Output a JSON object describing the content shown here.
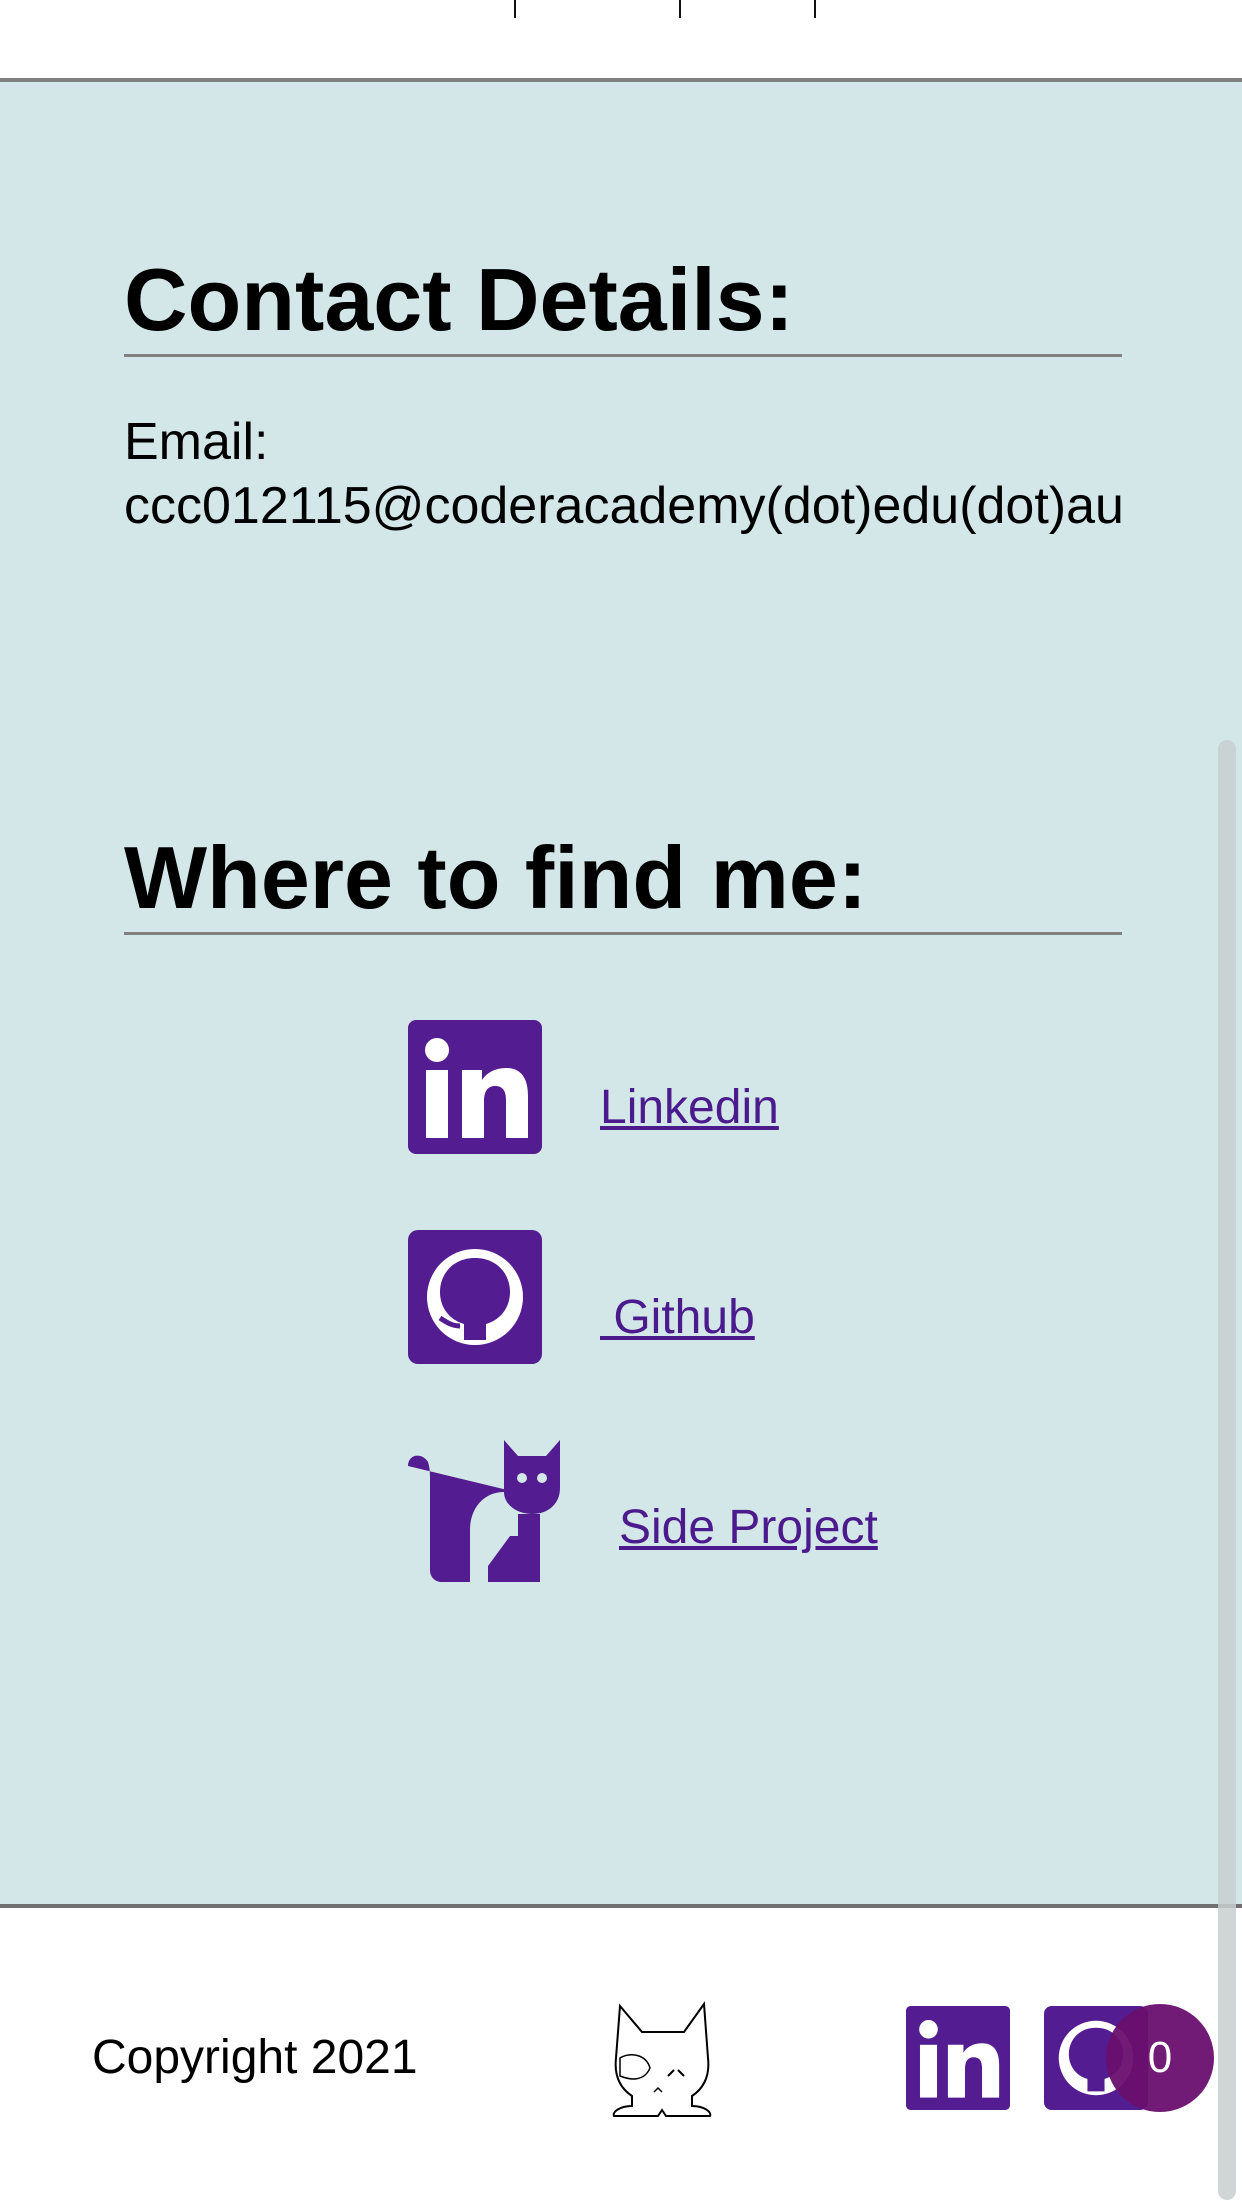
{
  "contact": {
    "title": "Contact Details:",
    "email_label": "Email:",
    "email_value": "ccc012115@coderacademy(dot)edu(dot)au"
  },
  "find_me": {
    "title": "Where to find me:",
    "links": [
      {
        "label": "Linkedin",
        "icon": "linkedin-icon"
      },
      {
        "label": " Github",
        "icon": "github-icon"
      },
      {
        "label": "Side Project",
        "icon": "cat-icon"
      }
    ]
  },
  "footer": {
    "copyright": "Copyright 2021",
    "badge_count": "0"
  },
  "colors": {
    "accent": "#4b1a8c",
    "background": "#d4e7e8",
    "badge": "#6a0f6f"
  }
}
